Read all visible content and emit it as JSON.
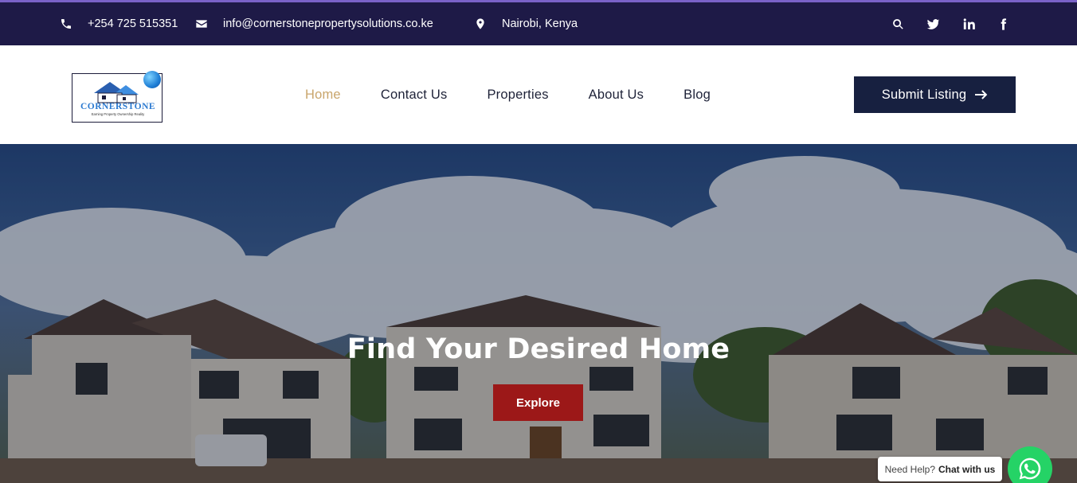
{
  "topbar": {
    "phone": "+254 725 515351",
    "email": "info@cornerstonepropertysolutions.co.ke",
    "location": "Nairobi, Kenya",
    "icons": [
      "phone-icon",
      "envelope-icon",
      "map-marker-icon",
      "search-icon",
      "twitter-icon",
      "linkedin-icon",
      "facebook-icon"
    ]
  },
  "logo": {
    "name": "CORNERSTONE",
    "tagline": "Earning Property Ownership Reality"
  },
  "nav": {
    "items": [
      {
        "label": "Home",
        "active": true
      },
      {
        "label": "Contact Us",
        "active": false
      },
      {
        "label": "Properties",
        "active": false
      },
      {
        "label": "About Us",
        "active": false
      },
      {
        "label": "Blog",
        "active": false
      }
    ]
  },
  "header": {
    "submit_label": "Submit Listing"
  },
  "hero": {
    "title": "Find Your Desired Home",
    "button_label": "Explore"
  },
  "chat": {
    "prompt": "Need Help?",
    "action": "Chat with us"
  },
  "colors": {
    "topbar_bg": "#1e1a47",
    "nav_active": "#c9a56b",
    "submit_bg": "#172040",
    "explore_bg": "#9c1818",
    "whatsapp": "#25d366"
  }
}
